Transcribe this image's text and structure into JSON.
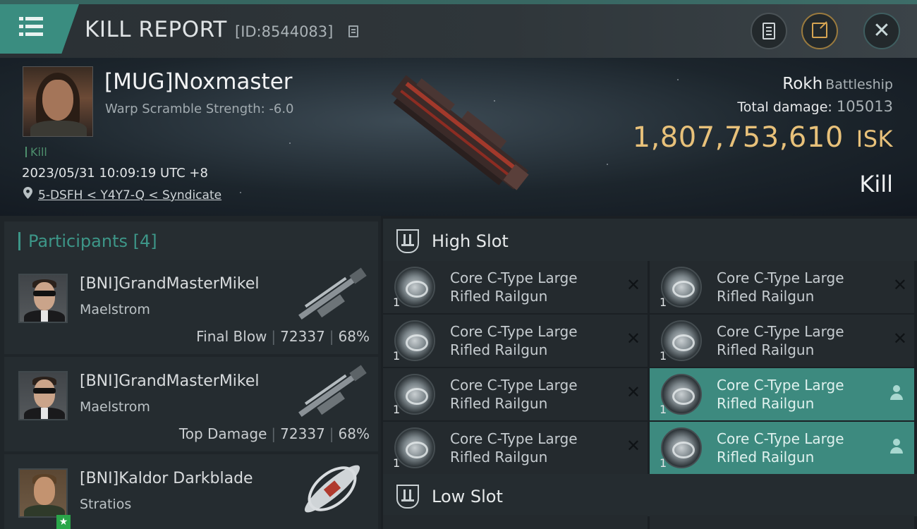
{
  "header": {
    "title": "KILL REPORT",
    "report_id": "[ID:8544083]"
  },
  "victim": {
    "name": "[MUG]Noxmaster",
    "warp_scramble": "Warp Scramble Strength: -6.0",
    "kill_tag": "Kill",
    "datetime": "2023/05/31 10:09:19 UTC +8",
    "location": "5-DSFH < Y4Y7-Q < Syndicate",
    "ship": "Rokh",
    "ship_type": "Battleship",
    "total_damage_label": "Total damage:",
    "total_damage": "105013",
    "isk_value": "1,807,753,610",
    "isk_unit": "ISK",
    "result": "Kill"
  },
  "participants": {
    "label": "Participants",
    "count": "[4]",
    "items": [
      {
        "name": "[BNI]GrandMasterMikel",
        "ship": "Maelstrom",
        "role": "Final Blow",
        "damage": "72337",
        "percent": "68%"
      },
      {
        "name": "[BNI]GrandMasterMikel",
        "ship": "Maelstrom",
        "role": "Top Damage",
        "damage": "72337",
        "percent": "68%"
      },
      {
        "name": "[BNI]Kaldor Darkblade",
        "ship": "Stratios",
        "role": "",
        "damage": "",
        "percent": ""
      }
    ]
  },
  "slots": {
    "high": {
      "label": "High Slot",
      "modules": [
        {
          "line1": "Core C-Type Large",
          "line2": "Rifled Railgun",
          "qty": "1",
          "status": "destroyed"
        },
        {
          "line1": "Core C-Type Large",
          "line2": "Rifled Railgun",
          "qty": "1",
          "status": "destroyed"
        },
        {
          "line1": "Core C-Type Large",
          "line2": "Rifled Railgun",
          "qty": "1",
          "status": "destroyed"
        },
        {
          "line1": "Core C-Type Large",
          "line2": "Rifled Railgun",
          "qty": "1",
          "status": "destroyed"
        },
        {
          "line1": "Core C-Type Large",
          "line2": "Rifled Railgun",
          "qty": "1",
          "status": "destroyed"
        },
        {
          "line1": "Core C-Type Large",
          "line2": "Rifled Railgun",
          "qty": "1",
          "status": "dropped"
        },
        {
          "line1": "Core C-Type Large",
          "line2": "Rifled Railgun",
          "qty": "1",
          "status": "destroyed"
        },
        {
          "line1": "Core C-Type Large",
          "line2": "Rifled Railgun",
          "qty": "1",
          "status": "dropped"
        }
      ]
    },
    "low": {
      "label": "Low Slot"
    }
  },
  "colors": {
    "accent": "#3d8a7f",
    "isk": "#e8c17a"
  },
  "icons": [
    "menu-icon",
    "copy-icon",
    "notes-icon",
    "share-icon",
    "close-icon",
    "location-pin-icon",
    "high-slot-icon",
    "low-slot-icon",
    "pilot-icon"
  ]
}
